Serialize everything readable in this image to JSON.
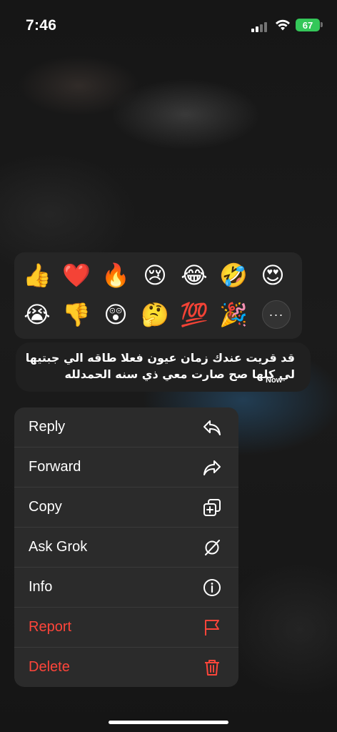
{
  "status_bar": {
    "time": "7:46",
    "battery": "67"
  },
  "reactions": {
    "row1": [
      "👍",
      "❤️",
      "🔥",
      "😢",
      "😂",
      "🤣",
      "😍"
    ],
    "row2": [
      "😭",
      "👎",
      "😲",
      "🤔",
      "💯",
      "🎉"
    ],
    "more_label": "···"
  },
  "message": {
    "text": "قد قريت عندك زمان عيون فعلا طاقه الي جبتيها لي كلها صح صارت معي ذي سنه الحمدلله",
    "time": "Now"
  },
  "menu": {
    "items": [
      {
        "label": "Reply",
        "icon": "reply-icon"
      },
      {
        "label": "Forward",
        "icon": "forward-icon"
      },
      {
        "label": "Copy",
        "icon": "copy-icon"
      },
      {
        "label": "Ask Grok",
        "icon": "grok-icon"
      },
      {
        "label": "Info",
        "icon": "info-icon"
      },
      {
        "label": "Report",
        "icon": "flag-icon"
      },
      {
        "label": "Delete",
        "icon": "trash-icon"
      }
    ]
  },
  "colors": {
    "danger": "#ff453a",
    "battery": "#34c759",
    "menu_bg": "#2b2b2b"
  }
}
